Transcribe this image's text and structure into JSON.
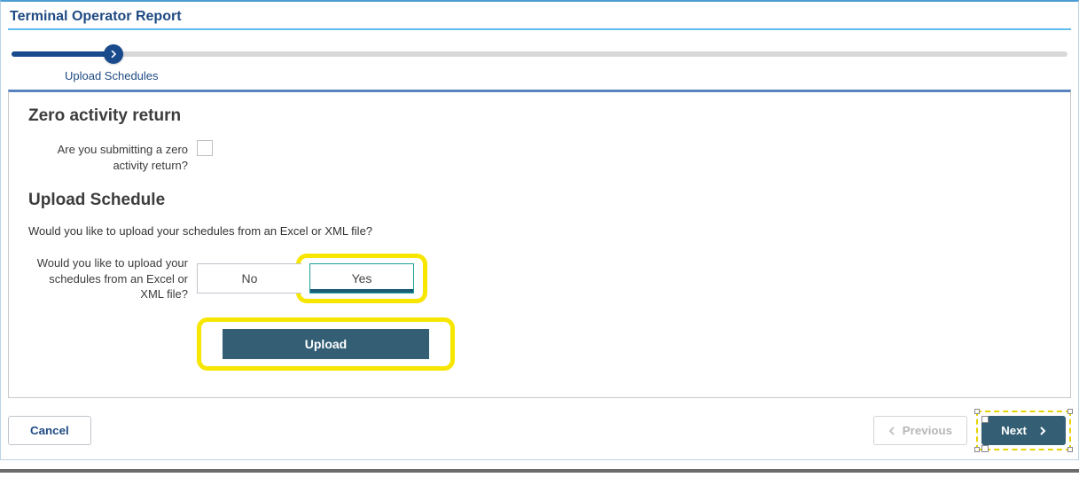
{
  "page": {
    "title": "Terminal Operator Report"
  },
  "wizard": {
    "current_step_label": "Upload Schedules"
  },
  "zero_activity": {
    "heading": "Zero activity return",
    "question": "Are you submitting a zero activity return?"
  },
  "upload_schedule": {
    "heading": "Upload Schedule",
    "intro": "Would you like to upload your schedules from an Excel or XML file?",
    "question": "Would you like to upload your schedules from an Excel or XML file?",
    "option_no": "No",
    "option_yes": "Yes",
    "upload_label": "Upload"
  },
  "footer": {
    "cancel": "Cancel",
    "previous": "Previous",
    "next": "Next"
  }
}
